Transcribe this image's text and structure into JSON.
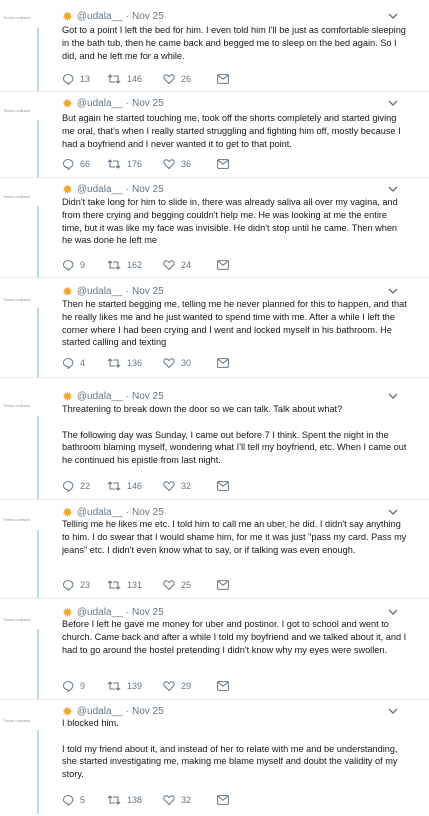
{
  "gutter_label": "Thread continued",
  "tweets": [
    {
      "handle": "@udala__",
      "date": "Nov 25",
      "paragraphs": [
        "Got to a point I left the bed for him. I even told him I'll be just as comfortable sleeping in the bath tub, then he came back and begged me to sleep on the bed again. So I did, and he left me for a while."
      ],
      "replies": "13",
      "retweets": "146",
      "likes": "26"
    },
    {
      "handle": "@udala__",
      "date": "Nov 25",
      "paragraphs": [
        "But again he started touching me, took off the shorts completely and started giving me oral, that's when I really started struggling and fighting him off, mostly because I had a boyfriend and I never wanted it to get to that point."
      ],
      "replies": "66",
      "retweets": "176",
      "likes": "36"
    },
    {
      "handle": "@udala__",
      "date": "Nov 25",
      "paragraphs": [
        "Didn't take long for him to slide in, there was already saliva all over my vagina, and from there crying and begging couldn't help me. He was looking at me the entire time, but it was like my face was invisible. He didn't stop until he came. Then when he was done he left me"
      ],
      "replies": "9",
      "retweets": "162",
      "likes": "24"
    },
    {
      "handle": "@udala__",
      "date": "Nov 25",
      "paragraphs": [
        "Then he started begging me, telling me he never planned for this to happen, and that he really likes me and he just wanted to spend time with me. After a while I left the corner where I had been crying and I went and locked myself in his bathroom. He started calling and texting"
      ],
      "replies": "4",
      "retweets": "136",
      "likes": "30"
    },
    {
      "handle": "@udala__",
      "date": "Nov 25",
      "paragraphs": [
        "Threatening to break down the door so we can talk. Talk about what?",
        "The following day was Sunday, I came out before 7 I think. Spent the night in the bathroom blaming myself, wondering what I'll tell my boyfriend, etc. When I came out he continued his epistle from last night."
      ],
      "replies": "22",
      "retweets": "146",
      "likes": "32"
    },
    {
      "handle": "@udala__",
      "date": "Nov 25",
      "paragraphs": [
        "Telling me he likes me etc. I told him to call me an uber, he did. I didn't say anything to him. I do swear that I would shame him, for me it was just \"pass my card. Pass my jeans\" etc. I didn't even know what to say, or if talking was even enough."
      ],
      "replies": "23",
      "retweets": "131",
      "likes": "25"
    },
    {
      "handle": "@udala__",
      "date": "Nov 25",
      "paragraphs": [
        "Before I left he gave me money for uber and postinor. I got to school and went to church. Came back and after a while I told my boyfriend and we talked about it, and I had to go around the hostel pretending I didn't know why my eyes were swollen."
      ],
      "replies": "9",
      "retweets": "139",
      "likes": "29"
    },
    {
      "handle": "@udala__",
      "date": "Nov 25",
      "paragraphs": [
        "I blocked him.",
        "I told my friend about it, and instead of her to relate with me and be understanding, she started investigating me, making me blame myself and doubt the validity of my story."
      ],
      "replies": "5",
      "retweets": "138",
      "likes": "32"
    }
  ]
}
